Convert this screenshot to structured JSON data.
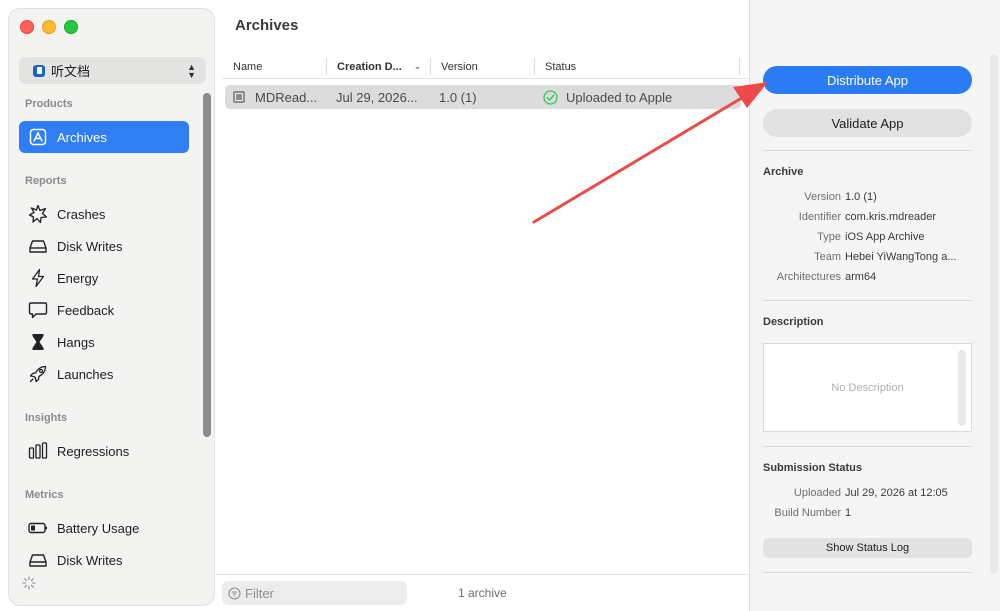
{
  "sidebar": {
    "scheme": "听文档",
    "sections": [
      {
        "header": "Products",
        "items": [
          {
            "label": "Archives",
            "icon": "archives-icon",
            "selected": true
          }
        ]
      },
      {
        "header": "Reports",
        "items": [
          {
            "label": "Crashes",
            "icon": "crashes-icon"
          },
          {
            "label": "Disk Writes",
            "icon": "disk-icon"
          },
          {
            "label": "Energy",
            "icon": "energy-icon"
          },
          {
            "label": "Feedback",
            "icon": "feedback-icon"
          },
          {
            "label": "Hangs",
            "icon": "hourglass-icon"
          },
          {
            "label": "Launches",
            "icon": "rocket-icon"
          }
        ]
      },
      {
        "header": "Insights",
        "items": [
          {
            "label": "Regressions",
            "icon": "regressions-icon"
          }
        ]
      },
      {
        "header": "Metrics",
        "items": [
          {
            "label": "Battery Usage",
            "icon": "battery-icon"
          },
          {
            "label": "Disk Writes",
            "icon": "disk-icon"
          }
        ]
      }
    ]
  },
  "main": {
    "title": "Archives",
    "columns": [
      "Name",
      "Creation D...",
      "Version",
      "Status"
    ],
    "rows": [
      {
        "name": "MDRead...",
        "created": "Jul 29, 2026...",
        "version": "1.0 (1)",
        "status": "Uploaded to Apple"
      }
    ],
    "filter_placeholder": "Filter",
    "count": "1 archive"
  },
  "inspector": {
    "distribute_label": "Distribute App",
    "validate_label": "Validate App",
    "archive_header": "Archive",
    "archive": [
      {
        "key": "Version",
        "value": "1.0 (1)"
      },
      {
        "key": "Identifier",
        "value": "com.kris.mdreader"
      },
      {
        "key": "Type",
        "value": "iOS App Archive"
      },
      {
        "key": "Team",
        "value": "Hebei YiWangTong a..."
      },
      {
        "key": "Architectures",
        "value": "arm64"
      }
    ],
    "description_header": "Description",
    "description_placeholder": "No Description",
    "submission_header": "Submission Status",
    "submission": [
      {
        "key": "Uploaded",
        "value": "Jul 29, 2026 at 12:05"
      },
      {
        "key": "Build Number",
        "value": "1"
      }
    ],
    "status_log_label": "Show Status Log"
  },
  "colors": {
    "accent": "#2b7cf4",
    "selection": "#2f7ef3",
    "success": "#34c759",
    "annotation_arrow": "#ee4a4a"
  }
}
